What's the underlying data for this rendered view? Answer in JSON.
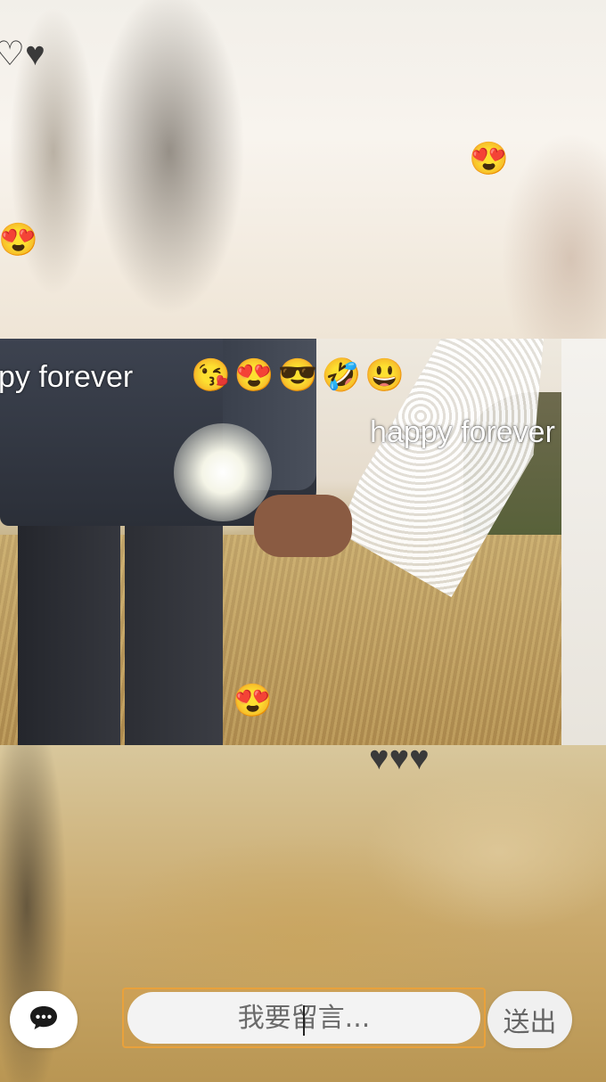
{
  "danmaku": {
    "hearts_top_left": "♡♥",
    "emoji_top_right": "😍",
    "emoji_left": "😍",
    "text_left_partial": "py forever",
    "emoji_row": "😘😍😎🤣😃",
    "text_right": "happy forever",
    "emoji_photo_bottom": "😍",
    "hearts_bottom": "♥♥♥"
  },
  "comment_bar": {
    "chat_icon": "chat-bubble-icon",
    "placeholder": "我要留言...",
    "value": "",
    "send_label": "送出"
  },
  "colors": {
    "input_focus_border": "#e9a13b",
    "button_background": "#ffffff"
  }
}
